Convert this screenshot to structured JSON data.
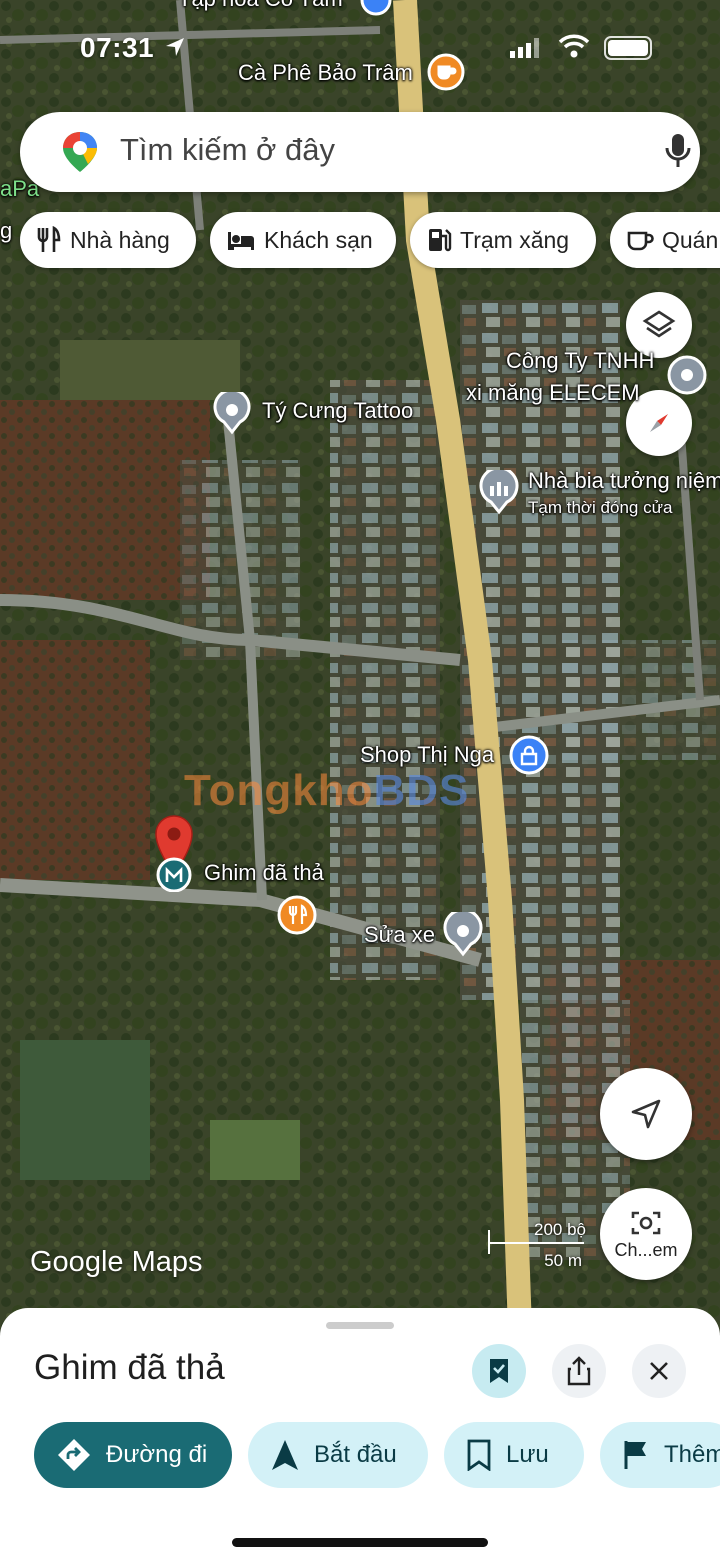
{
  "status_bar": {
    "time": "07:31"
  },
  "search": {
    "placeholder": "Tìm kiếm ở đây"
  },
  "chips": [
    {
      "label": "Nhà hàng",
      "icon": "restaurant-icon"
    },
    {
      "label": "Khách sạn",
      "icon": "hotel-icon"
    },
    {
      "label": "Trạm xăng",
      "icon": "gas-station-icon"
    },
    {
      "label": "Quán",
      "icon": "coffee-icon"
    }
  ],
  "map": {
    "top_partial_label": "Tạp hóa Cô Tâm",
    "left_edge_label_1": "aPa",
    "left_edge_label_2": "g",
    "poi_labels": {
      "cafe": "Cà Phê Bảo Trâm",
      "company_1": "Công Ty TNHH",
      "company_2": "xi măng ELECEM",
      "tattoo": "Tý Cưng Tattoo",
      "memorial": "Nhà bia tưởng niệm",
      "memorial_status": "Tạm thời đóng cửa",
      "shop": "Shop Thị Nga",
      "dropped_pin": "Ghim đã thả",
      "repair": "Sửa xe"
    },
    "watermark": {
      "part1": "Tongkho",
      "part2": "BDS"
    },
    "attribution": "Google Maps",
    "scale": {
      "imperial": "200 bộ",
      "metric": "50 m"
    },
    "camera_button_label": "Ch...em"
  },
  "sheet": {
    "title": "Ghim đã thả",
    "actions": [
      {
        "label": "Đường đi",
        "icon": "directions-icon"
      },
      {
        "label": "Bắt đầu",
        "icon": "navigation-start-icon"
      },
      {
        "label": "Lưu",
        "icon": "bookmark-icon"
      },
      {
        "label": "Thêm",
        "icon": "flag-icon"
      }
    ]
  },
  "colors": {
    "primary_teal": "#1a6b74",
    "chip_light_teal": "#d3f1f7",
    "pin_red": "#e03a2f",
    "road_yellow": "#d9c27a",
    "poi_orange": "#f08a24",
    "poi_blue": "#3b82f6"
  }
}
